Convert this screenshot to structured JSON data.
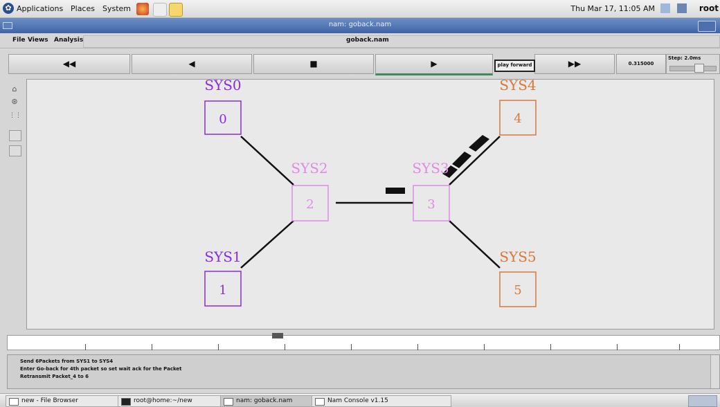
{
  "top_panel": {
    "menus": [
      "Applications",
      "Places",
      "System"
    ],
    "clock": "Thu Mar 17, 11:05 AM",
    "user": "root"
  },
  "window": {
    "title": "nam: goback.nam"
  },
  "menubar": {
    "items": [
      "File",
      "Views",
      "Analysis"
    ],
    "filename": "goback.nam"
  },
  "toolbar": {
    "rewind": "◀◀",
    "back": "◀",
    "stop": "■",
    "play": "▶",
    "fast_forward": "▶▶",
    "play_forward_label": "play forward",
    "time": "0.315000",
    "step_label": "Step: 2.0ms"
  },
  "network": {
    "nodes": [
      {
        "id": "0",
        "label": "SYS0",
        "color": "#8a2be2"
      },
      {
        "id": "1",
        "label": "SYS1",
        "color": "#8a2be2"
      },
      {
        "id": "2",
        "label": "SYS2",
        "color": "#e08ae8"
      },
      {
        "id": "3",
        "label": "SYS3",
        "color": "#e08ae8"
      },
      {
        "id": "4",
        "label": "SYS4",
        "color": "#d8783a"
      },
      {
        "id": "5",
        "label": "SYS5",
        "color": "#d8783a"
      }
    ],
    "links": [
      [
        "0",
        "2"
      ],
      [
        "1",
        "2"
      ],
      [
        "2",
        "3"
      ],
      [
        "3",
        "4"
      ],
      [
        "3",
        "5"
      ]
    ]
  },
  "log": {
    "lines": [
      "Send 6Packets from SYS1 to SYS4",
      "Enter Go-back for 4th packet so set wait ack for the Packet",
      "Retransmit Packet_4 to 6"
    ]
  },
  "taskbar": {
    "items": [
      "new - File Browser",
      "root@home:~/new",
      "nam: goback.nam",
      "Nam Console v1.15"
    ]
  }
}
